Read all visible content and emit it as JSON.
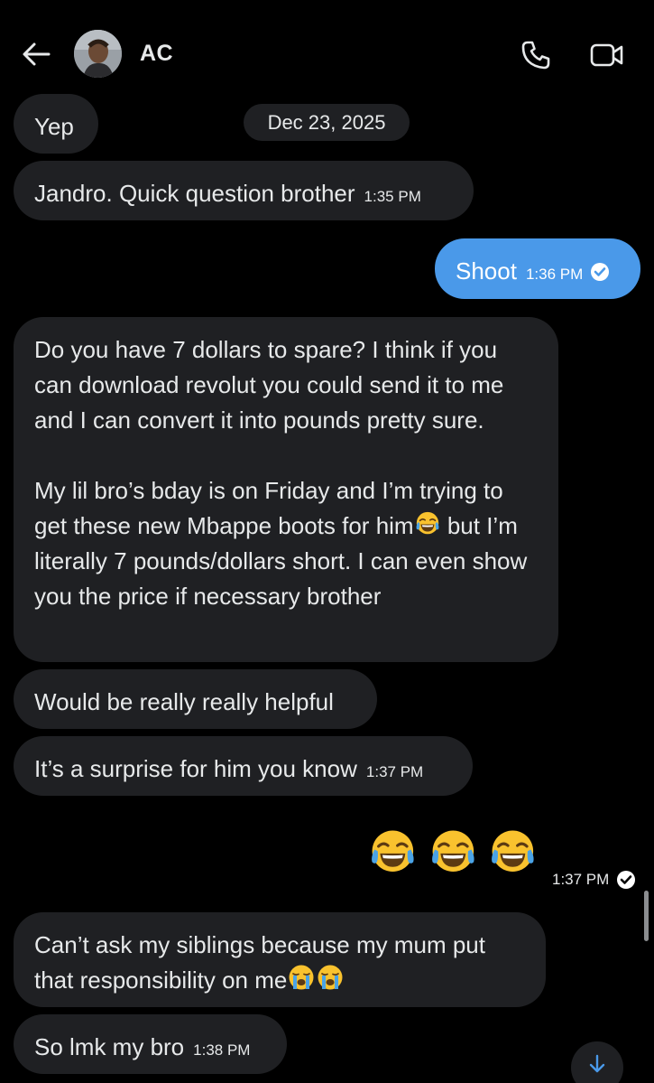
{
  "header": {
    "contact_name": "AC",
    "icons": {
      "back": "arrow-left-icon",
      "call": "phone-icon",
      "video": "video-camera-icon"
    }
  },
  "thread": {
    "date_divider": "Dec 23, 2025",
    "messages": [
      {
        "direction": "in",
        "text": "Yep"
      },
      {
        "direction": "in",
        "text": "Jandro. Quick question brother",
        "time": "1:35 PM"
      },
      {
        "direction": "out",
        "text": "Shoot",
        "time": "1:36 PM",
        "status": "read"
      },
      {
        "direction": "in",
        "paragraphs": [
          "Do you have 7 dollars to spare? I think if you can download revolut you could send it to me and I can convert it into pounds pretty sure.",
          "My lil bro’s bday is on Friday and I’m trying to get these new Mbappe boots for him",
          "but I’m literally 7 pounds/dollars short.  I can even show you the price if necessary brother"
        ]
      },
      {
        "direction": "in",
        "text": "Would be really really helpful"
      },
      {
        "direction": "in",
        "text": "It’s a surprise for him you know",
        "time": "1:37 PM"
      },
      {
        "direction": "out",
        "emoji_count": 3,
        "emoji": "face-with-tears-of-joy",
        "time": "1:37 PM",
        "status": "read"
      },
      {
        "direction": "in",
        "text": "Can’t ask my siblings because my mum put that responsibility on me"
      },
      {
        "direction": "in",
        "text": "So lmk my bro",
        "time": "1:38 PM"
      }
    ]
  },
  "colors": {
    "background": "#000000",
    "incoming_bubble": "#1f2023",
    "outgoing_bubble": "#4a99e9",
    "text": "#e7e9ea"
  }
}
